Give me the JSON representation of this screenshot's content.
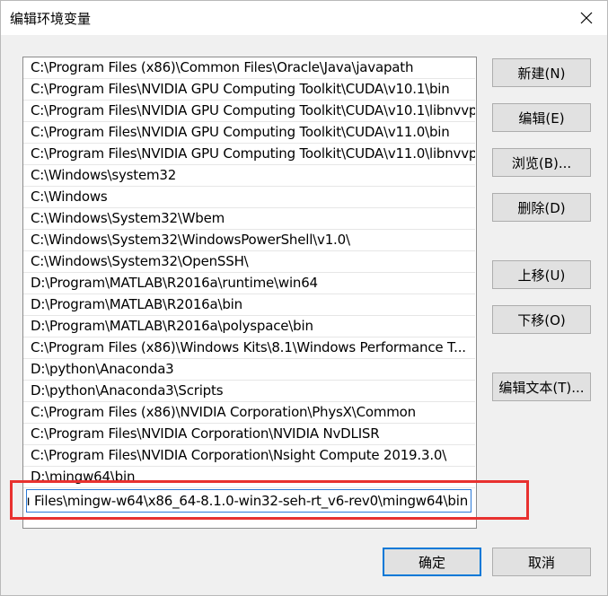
{
  "window": {
    "title": "编辑环境变量",
    "close_icon": "close-icon"
  },
  "path_list": [
    "C:\\Program Files (x86)\\Common Files\\Oracle\\Java\\javapath",
    "C:\\Program Files\\NVIDIA GPU Computing Toolkit\\CUDA\\v10.1\\bin",
    "C:\\Program Files\\NVIDIA GPU Computing Toolkit\\CUDA\\v10.1\\libnvvp",
    "C:\\Program Files\\NVIDIA GPU Computing Toolkit\\CUDA\\v11.0\\bin",
    "C:\\Program Files\\NVIDIA GPU Computing Toolkit\\CUDA\\v11.0\\libnvvp",
    "C:\\Windows\\system32",
    "C:\\Windows",
    "C:\\Windows\\System32\\Wbem",
    "C:\\Windows\\System32\\WindowsPowerShell\\v1.0\\",
    "C:\\Windows\\System32\\OpenSSH\\",
    "D:\\Program\\MATLAB\\R2016a\\runtime\\win64",
    "D:\\Program\\MATLAB\\R2016a\\bin",
    "D:\\Program\\MATLAB\\R2016a\\polyspace\\bin",
    "C:\\Program Files (x86)\\Windows Kits\\8.1\\Windows Performance T...",
    "D:\\python\\Anaconda3",
    "D:\\python\\Anaconda3\\Scripts",
    "C:\\Program Files (x86)\\NVIDIA Corporation\\PhysX\\Common",
    "C:\\Program Files\\NVIDIA Corporation\\NVIDIA NvDLISR",
    "C:\\Program Files\\NVIDIA Corporation\\Nsight Compute 2019.3.0\\",
    "D:\\mingw64\\bin"
  ],
  "edit_field": {
    "value": "ı Files\\mingw-w64\\x86_64-8.1.0-win32-seh-rt_v6-rev0\\mingw64\\bin"
  },
  "buttons": {
    "new": "新建(N)",
    "edit": "编辑(E)",
    "browse": "浏览(B)...",
    "delete": "删除(D)",
    "move_up": "上移(U)",
    "move_down": "下移(O)",
    "edit_text": "编辑文本(T)...",
    "ok": "确定",
    "cancel": "取消"
  },
  "colors": {
    "highlight_box": "#e8312f",
    "focus_border": "#0078d7"
  }
}
